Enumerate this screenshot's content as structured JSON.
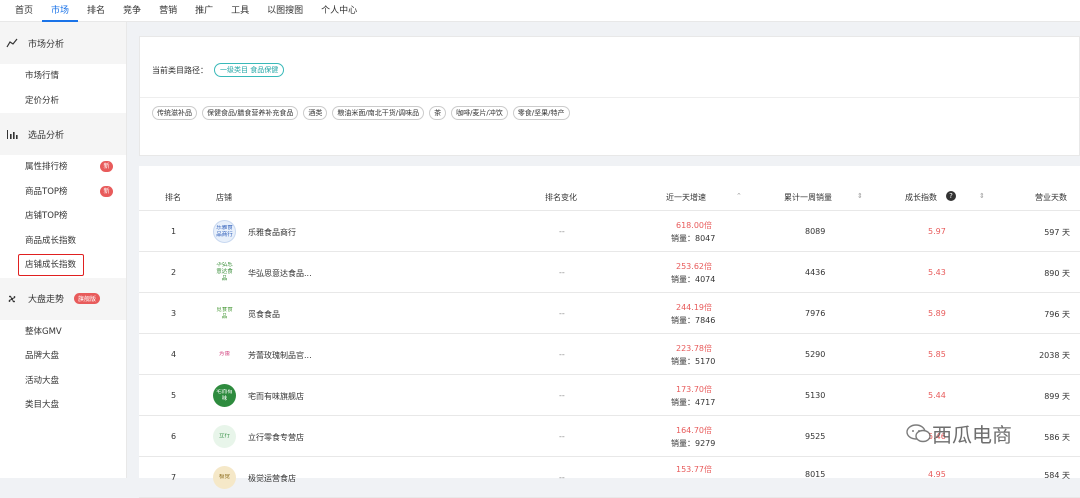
{
  "topnav": [
    "首页",
    "市场",
    "排名",
    "竞争",
    "营销",
    "推广",
    "工具",
    "以图搜图",
    "个人中心"
  ],
  "topnav_active": 1,
  "sidebar": {
    "sections": [
      {
        "label": "市场分析",
        "icon": "line-chart-icon",
        "items": [
          {
            "label": "市场行情"
          },
          {
            "label": "定价分析"
          }
        ]
      },
      {
        "label": "选品分析",
        "icon": "bar-chart-icon",
        "items": [
          {
            "label": "属性排行榜",
            "badge": "新"
          },
          {
            "label": "商品TOP榜",
            "badge": "新"
          },
          {
            "label": "店铺TOP榜"
          },
          {
            "label": "商品成长指数"
          },
          {
            "label": "店铺成长指数"
          }
        ]
      },
      {
        "label": "大盘走势",
        "icon": "fan-icon",
        "tag": "旗舰版",
        "items": [
          {
            "label": "整体GMV"
          },
          {
            "label": "品牌大盘"
          },
          {
            "label": "活动大盘"
          },
          {
            "label": "类目大盘"
          }
        ]
      }
    ]
  },
  "category": {
    "path_label": "当前类目路径：",
    "path_tag": "一级类目 食品保健",
    "chips": [
      "传统滋补品",
      "保健食品/膳食营养补充食品",
      "酒类",
      "粮油米面/南北干货/调味品",
      "茶",
      "咖啡/麦片/冲饮",
      "零食/坚果/特产"
    ]
  },
  "table": {
    "headers": {
      "rank": "排名",
      "shop": "店铺",
      "rank_change": "排名变化",
      "speed": "近一天增速",
      "weekly_sales": "累计一周销量",
      "growth_index": "成长指数",
      "days": "营业天数"
    },
    "rows": [
      {
        "rank": "1",
        "shop": "乐雅食品商行",
        "logo_text": "乐雅食品商行",
        "change": "--",
        "speed": "618.00倍",
        "sales_line": "销量：8047",
        "weekly": "8089",
        "index": "5.97",
        "days": "597 天"
      },
      {
        "rank": "2",
        "shop": "华弘思意达食品...",
        "logo_text": "华弘思意达食品",
        "change": "--",
        "speed": "253.62倍",
        "sales_line": "销量：4074",
        "weekly": "4436",
        "index": "5.43",
        "days": "890 天"
      },
      {
        "rank": "3",
        "shop": "觅食食品",
        "logo_text": "觅食食品",
        "change": "--",
        "speed": "244.19倍",
        "sales_line": "销量：7846",
        "weekly": "7976",
        "index": "5.89",
        "days": "796 天"
      },
      {
        "rank": "4",
        "shop": "芳蕾玫瑰制品官...",
        "logo_text": "芳蕾",
        "change": "--",
        "speed": "223.78倍",
        "sales_line": "销量：5170",
        "weekly": "5290",
        "index": "5.85",
        "days": "2038 天"
      },
      {
        "rank": "5",
        "shop": "宅而有味旗舰店",
        "logo_text": "宅而有味",
        "change": "--",
        "speed": "173.70倍",
        "sales_line": "销量：4717",
        "weekly": "5130",
        "index": "5.44",
        "days": "899 天"
      },
      {
        "rank": "6",
        "shop": "立行零食专营店",
        "logo_text": "立行",
        "change": "--",
        "speed": "164.70倍",
        "sales_line": "销量：9279",
        "weekly": "9525",
        "index": "5.46",
        "days": "586 天"
      },
      {
        "rank": "7",
        "shop": "极觉运营食店",
        "logo_text": "极觉",
        "change": "--",
        "speed": "153.77倍",
        "sales_line": "",
        "weekly": "8015",
        "index": "4.95",
        "days": "584 天"
      }
    ]
  },
  "watermark": "西瓜电商",
  "colors": {
    "accent": "#1a73e8",
    "red": "#e85b5b",
    "teal": "#1fa5a5",
    "highlight_box": "#e02020"
  }
}
